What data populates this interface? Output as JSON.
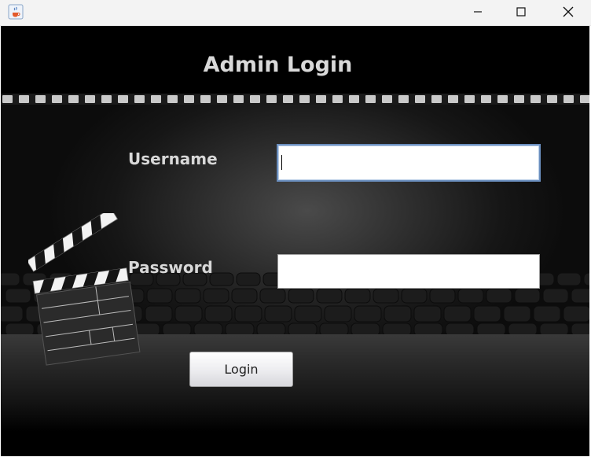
{
  "window": {
    "app_icon": "java-cup-icon",
    "controls": [
      "minimize-icon",
      "maximize-icon",
      "close-icon"
    ]
  },
  "form": {
    "title": "Admin Login",
    "username_label": "Username",
    "username_value": "",
    "password_label": "Password",
    "password_value": "",
    "login_label": "Login"
  },
  "colors": {
    "background": "#000000",
    "title_text": "#d9d9d9",
    "focus_border": "#6b8fbf"
  }
}
